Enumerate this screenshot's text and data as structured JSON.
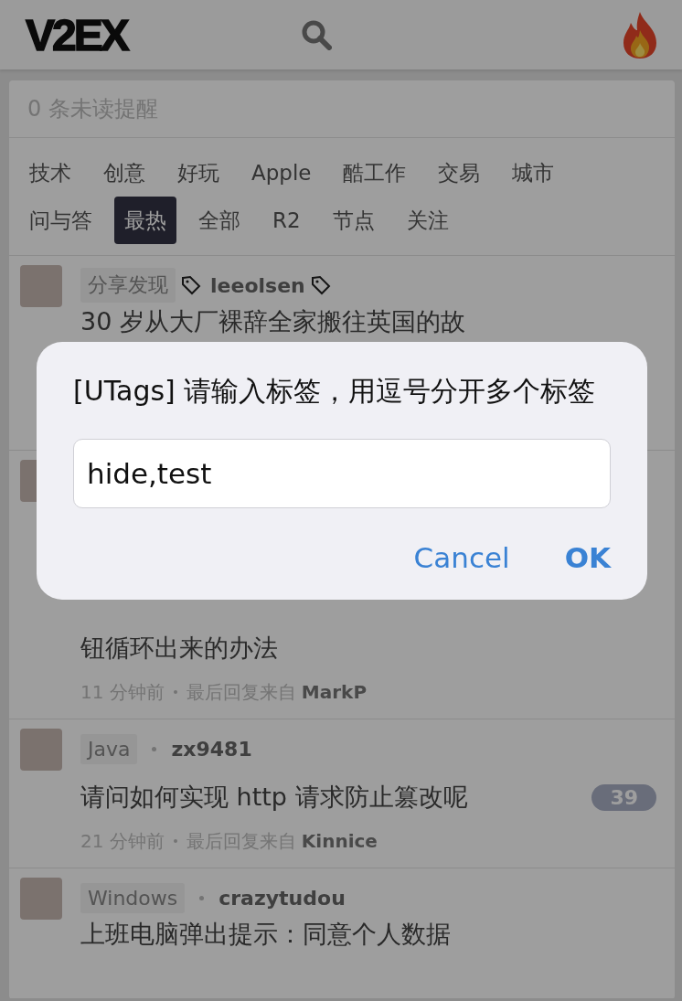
{
  "header": {
    "logo": "V2EX"
  },
  "notifications": {
    "text": "0 条未读提醒"
  },
  "tabs": [
    {
      "label": "技术",
      "selected": false
    },
    {
      "label": "创意",
      "selected": false
    },
    {
      "label": "好玩",
      "selected": false
    },
    {
      "label": "Apple",
      "selected": false
    },
    {
      "label": "酷工作",
      "selected": false
    },
    {
      "label": "交易",
      "selected": false
    },
    {
      "label": "城市",
      "selected": false
    },
    {
      "label": "问与答",
      "selected": false
    },
    {
      "label": "最热",
      "selected": true
    },
    {
      "label": "全部",
      "selected": false
    },
    {
      "label": "R2",
      "selected": false
    },
    {
      "label": "节点",
      "selected": false
    },
    {
      "label": "关注",
      "selected": false
    }
  ],
  "topics": [
    {
      "kind": "covered-bottom",
      "node": "分享发现",
      "author": "leeolsen",
      "tag_icons": true,
      "title": "30 岁从大厂裸辞全家搬往英国的故"
    },
    {
      "kind": "covered-top",
      "title": "钮循环出来的办法",
      "time": "11 分钟前",
      "last_reply_label": "最后回复来自",
      "last_reply_by": "MarkP"
    },
    {
      "kind": "full",
      "node": "Java",
      "author": "zx9481",
      "tag_icons": false,
      "title": "请问如何实现 http 请求防止篡改呢",
      "replies": "39",
      "time": "21 分钟前",
      "last_reply_label": "最后回复来自",
      "last_reply_by": "Kinnice"
    },
    {
      "kind": "covered-bottom",
      "node": "Windows",
      "author": "crazytudou",
      "tag_icons": false,
      "title": "上班电脑弹出提示：同意个人数据"
    }
  ],
  "dialog": {
    "message": "[UTags] 请输入标签，用逗号分开多个标签",
    "value": "hide,test",
    "buttons": [
      {
        "label": "Cancel",
        "kind": "cancel"
      },
      {
        "label": "OK",
        "kind": "confirm"
      }
    ]
  }
}
